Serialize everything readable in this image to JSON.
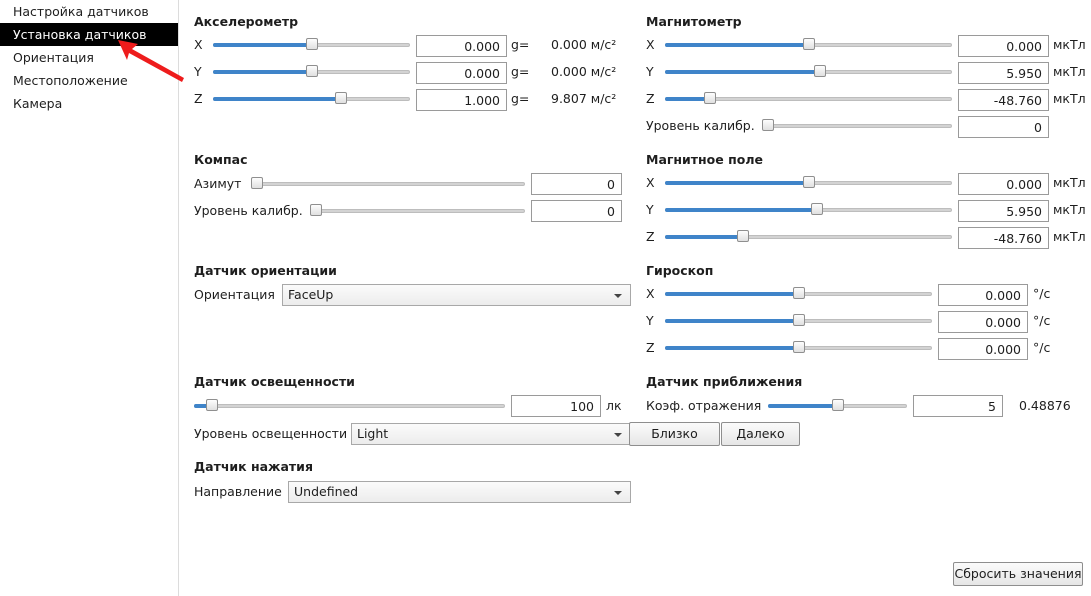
{
  "sidebar": {
    "items": [
      {
        "label": "Настройка датчиков",
        "active": false
      },
      {
        "label": "Установка датчиков",
        "active": true
      },
      {
        "label": "Ориентация",
        "active": false
      },
      {
        "label": "Местоположение",
        "active": false
      },
      {
        "label": "Камера",
        "active": false
      }
    ]
  },
  "accelerometer": {
    "title": "Акселерометр",
    "axes": [
      {
        "label": "X",
        "value": "0.000",
        "unit": "g=",
        "derived": "0.000 м/с²",
        "slider_fraction": 0.5
      },
      {
        "label": "Y",
        "value": "0.000",
        "unit": "g=",
        "derived": "0.000 м/с²",
        "slider_fraction": 0.5
      },
      {
        "label": "Z",
        "value": "1.000",
        "unit": "g=",
        "derived": "9.807 м/с²",
        "slider_fraction": 0.66
      }
    ]
  },
  "magnetometer": {
    "title": "Магнитометр",
    "axes": [
      {
        "label": "X",
        "value": "0.000",
        "unit": "мкТл",
        "slider_fraction": 0.5
      },
      {
        "label": "Y",
        "value": "5.950",
        "unit": "мкТл",
        "slider_fraction": 0.54
      },
      {
        "label": "Z",
        "value": "-48.760",
        "unit": "мкТл",
        "slider_fraction": 0.14
      }
    ],
    "calib_label": "Уровень калибр.",
    "calib_value": "0",
    "calib_fraction": 0.0
  },
  "compass": {
    "title": "Компас",
    "azimuth_label": "Азимут",
    "azimuth_value": "0",
    "azimuth_fraction": 0.0,
    "calib_label": "Уровень калибр.",
    "calib_value": "0",
    "calib_fraction": 0.0
  },
  "magnetic_field": {
    "title": "Магнитное поле",
    "axes": [
      {
        "label": "X",
        "value": "0.000",
        "unit": "мкТл",
        "slider_fraction": 0.5
      },
      {
        "label": "Y",
        "value": "5.950",
        "unit": "мкТл",
        "slider_fraction": 0.53
      },
      {
        "label": "Z",
        "value": "-48.760",
        "unit": "мкТл",
        "slider_fraction": 0.26
      }
    ]
  },
  "orientation_sensor": {
    "title": "Датчик ориентации",
    "label": "Ориентация",
    "value": "FaceUp"
  },
  "gyroscope": {
    "title": "Гироскоп",
    "axes": [
      {
        "label": "X",
        "value": "0.000",
        "unit": "°/c",
        "slider_fraction": 0.5
      },
      {
        "label": "Y",
        "value": "0.000",
        "unit": "°/c",
        "slider_fraction": 0.5
      },
      {
        "label": "Z",
        "value": "0.000",
        "unit": "°/c",
        "slider_fraction": 0.5
      }
    ]
  },
  "light_sensor": {
    "title": "Датчик освещенности",
    "value": "100",
    "unit": "лк",
    "slider_fraction": 0.04,
    "level_label": "Уровень освещенности",
    "level_value": "Light"
  },
  "proximity_sensor": {
    "title": "Датчик приближения",
    "label": "Коэф. отражения",
    "value": "5",
    "slider_fraction": 0.5,
    "reflectance": "0.48876",
    "near_label": "Близко",
    "far_label": "Далеко"
  },
  "pressure_sensor": {
    "title": "Датчик нажатия",
    "label": "Направление",
    "value": "Undefined"
  },
  "reset_label": "Сбросить значения",
  "colors": {
    "accent": "#3f84c9",
    "active_nav_bg": "#000000",
    "arrow": "#ee1c1c"
  }
}
